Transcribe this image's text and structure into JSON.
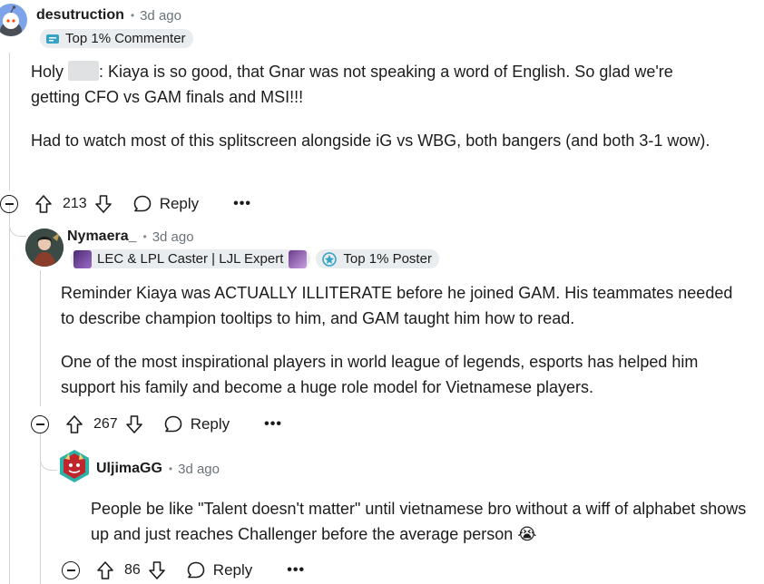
{
  "comments": [
    {
      "author": "desutruction",
      "age": "3d ago",
      "flairs": [
        "Top 1% Commenter"
      ],
      "body_line1_pre": "Holy ",
      "body_line1_post": ": Kiaya is so good, that Gnar was not speaking a word of English. So glad we're",
      "body_line2": "getting CFO vs GAM finals and MSI!!!",
      "paragraph2": "Had to watch most of this splitscreen alongside iG vs WBG, both bangers (and both 3-1 wow).",
      "upvotes": "213",
      "reply_label": "Reply",
      "more_label": "•••"
    },
    {
      "author": "Nymaera_",
      "age": "3d ago",
      "flairs": [
        "LEC & LPL Caster | LJL Expert",
        "Top 1% Poster"
      ],
      "paragraph1": "Reminder Kiaya was ACTUALLY ILLITERATE before he joined GAM. His teammates needed to describe champion tooltips to him, and GAM taught him how to read.",
      "paragraph2": "One of the most inspirational players in world league of legends, esports has helped him support his family and become a huge role model for Vietnamese players.",
      "upvotes": "267",
      "reply_label": "Reply",
      "more_label": "•••"
    },
    {
      "author": "UljimaGG",
      "age": "3d ago",
      "paragraph1": "People be like \"Talent doesn't matter\" until vietnamese bro without a wiff of alphabet shows up and just reaches Challenger before the average person",
      "emoji": "😭",
      "upvotes": "86",
      "reply_label": "Reply",
      "more_label": "•••"
    }
  ],
  "icons": {
    "upvote": "upvote-arrow-icon",
    "downvote": "downvote-arrow-icon",
    "reply": "speech-bubble-icon",
    "collapse": "minus-circle-icon"
  },
  "colors": {
    "flair_bg": "#eaedef",
    "thread_line": "#d0d4d7",
    "meta_gray": "#6a7379",
    "avatar_blue": "#7fa3e8",
    "achievement_teal": "#34a3c4"
  }
}
